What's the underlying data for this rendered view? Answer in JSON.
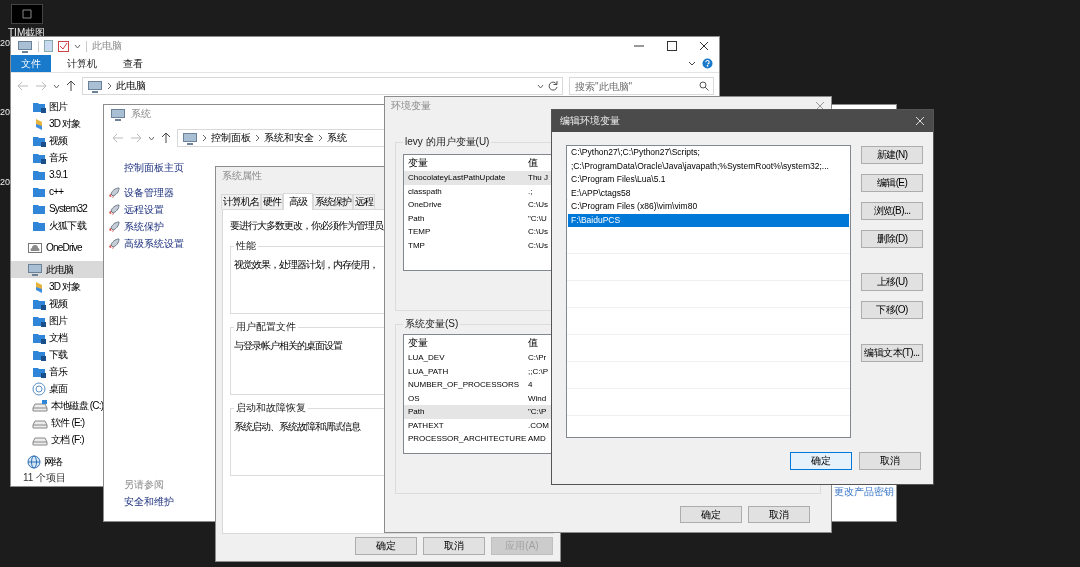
{
  "desktop": {
    "icon_label": "TIM截图",
    "hidden_labels": [
      "20",
      "20",
      "20"
    ]
  },
  "explorer": {
    "title": "此电脑",
    "ribbon_tabs": [
      {
        "label": "文件",
        "selected": true
      },
      {
        "label": "计算机",
        "selected": false
      },
      {
        "label": "查看",
        "selected": false
      }
    ],
    "address": "此电脑",
    "search_placeholder": "搜索\"此电脑\"",
    "quick_access": [
      {
        "label": "图片",
        "kind": "library",
        "selected": false
      },
      {
        "label": "3D 对象",
        "kind": "objects3d",
        "selected": false
      },
      {
        "label": "视频",
        "kind": "library",
        "selected": false
      },
      {
        "label": "音乐",
        "kind": "library",
        "selected": false
      },
      {
        "label": "3.9.1",
        "kind": "folder",
        "selected": false
      },
      {
        "label": "c++",
        "kind": "folder",
        "selected": false
      },
      {
        "label": "System32",
        "kind": "folder",
        "selected": false
      },
      {
        "label": "火狐下载",
        "kind": "folder",
        "selected": false
      }
    ],
    "nav": [
      {
        "label": "OneDrive",
        "kind": "onedrive",
        "selected": false
      },
      {
        "label": "此电脑",
        "kind": "pc",
        "selected": true,
        "children": [
          {
            "label": "3D 对象",
            "kind": "objects3d",
            "selected": false
          },
          {
            "label": "视频",
            "kind": "library",
            "selected": false
          },
          {
            "label": "图片",
            "kind": "library",
            "selected": false
          },
          {
            "label": "文档",
            "kind": "library",
            "selected": false
          },
          {
            "label": "下载",
            "kind": "library",
            "selected": false
          },
          {
            "label": "音乐",
            "kind": "library",
            "selected": false
          },
          {
            "label": "桌面",
            "kind": "desktop",
            "selected": false
          },
          {
            "label": "本地磁盘 (C:)",
            "kind": "system_drive",
            "selected": false
          },
          {
            "label": "软件 (E:)",
            "kind": "drive",
            "selected": false
          },
          {
            "label": "文档 (F:)",
            "kind": "drive",
            "selected": false
          }
        ]
      },
      {
        "label": "网络",
        "kind": "network",
        "selected": false
      }
    ],
    "status": "11 个项目"
  },
  "system": {
    "title": "系统",
    "breadcrumb": [
      "控制面板",
      "系统和安全",
      "系统"
    ],
    "home_link": "控制面板主页",
    "tasks": [
      "设备管理器",
      "远程设置",
      "系统保护",
      "高级系统设置"
    ],
    "see_also_heading": "另请参阅",
    "see_also": [
      "安全和维护"
    ],
    "product_key_link": "更改产品密钥"
  },
  "system_properties": {
    "title": "系统属性",
    "tabs": [
      {
        "label": "计算机名",
        "selected": false
      },
      {
        "label": "硬件",
        "selected": false
      },
      {
        "label": "高级",
        "selected": true
      },
      {
        "label": "系统保护",
        "selected": false
      },
      {
        "label": "远程",
        "selected": false
      }
    ],
    "intro": "要进行大多数更改，你必须作为管理员",
    "groups": [
      {
        "title": "性能",
        "text": "视觉效果，处理器计划，内存使用，"
      },
      {
        "title": "用户配置文件",
        "text": "与登录帐户相关的桌面设置"
      },
      {
        "title": "启动和故障恢复",
        "text": "系统启动、系统故障和调试信息"
      }
    ],
    "buttons": [
      {
        "label": "确定",
        "disabled": false
      },
      {
        "label": "取消",
        "disabled": false
      },
      {
        "label": "应用(A)",
        "disabled": true
      }
    ]
  },
  "env_vars": {
    "title": "环境变量",
    "user_heading": "levy 的用户变量(U)",
    "user_columns": [
      "变量",
      "值"
    ],
    "user_rows": [
      {
        "name": "ChocolateyLastPathUpdate",
        "value": "Thu J",
        "selected": true
      },
      {
        "name": "classpath",
        "value": ".;",
        "selected": false
      },
      {
        "name": "OneDrive",
        "value": "C:\\Us",
        "selected": false
      },
      {
        "name": "Path",
        "value": "\"C:\\U",
        "selected": false
      },
      {
        "name": "TEMP",
        "value": "C:\\Us",
        "selected": false
      },
      {
        "name": "TMP",
        "value": "C:\\Us",
        "selected": false
      }
    ],
    "system_heading": "系统变量(S)",
    "system_columns": [
      "变量",
      "值"
    ],
    "system_rows": [
      {
        "name": "LUA_DEV",
        "value": "C:\\Pr",
        "selected": false
      },
      {
        "name": "LUA_PATH",
        "value": ";;C:\\P",
        "selected": false
      },
      {
        "name": "NUMBER_OF_PROCESSORS",
        "value": "4",
        "selected": false
      },
      {
        "name": "OS",
        "value": "Wind",
        "selected": false
      },
      {
        "name": "Path",
        "value": "\"C:\\P",
        "selected": true
      },
      {
        "name": "PATHEXT",
        "value": ".COM",
        "selected": false
      },
      {
        "name": "PROCESSOR_ARCHITECTURE",
        "value": "AMD",
        "selected": false
      }
    ],
    "buttons": [
      "确定",
      "取消"
    ]
  },
  "edit_dialog": {
    "title": "编辑环境变量",
    "entries": [
      {
        "text": "C:\\Python27\\;C:\\Python27\\Scripts;",
        "selected": false
      },
      {
        "text": ";C:\\ProgramData\\Oracle\\Java\\javapath;%SystemRoot%\\system32;...",
        "selected": false
      },
      {
        "text": "C:\\Program Files\\Lua\\5.1",
        "selected": false
      },
      {
        "text": "E:\\APP\\ctags58",
        "selected": false
      },
      {
        "text": "C:\\Program Files (x86)\\vim\\vim80",
        "selected": false
      },
      {
        "text": "F:\\BaiduPCS",
        "selected": true
      }
    ],
    "button_groups": [
      [
        "新建(N)",
        "编辑(E)",
        "浏览(B)...",
        "删除(D)"
      ],
      [
        "上移(U)",
        "下移(O)"
      ],
      [
        "编辑文本(T)..."
      ]
    ],
    "footer_buttons": [
      {
        "label": "确定",
        "default": true
      },
      {
        "label": "取消",
        "default": false
      }
    ]
  }
}
